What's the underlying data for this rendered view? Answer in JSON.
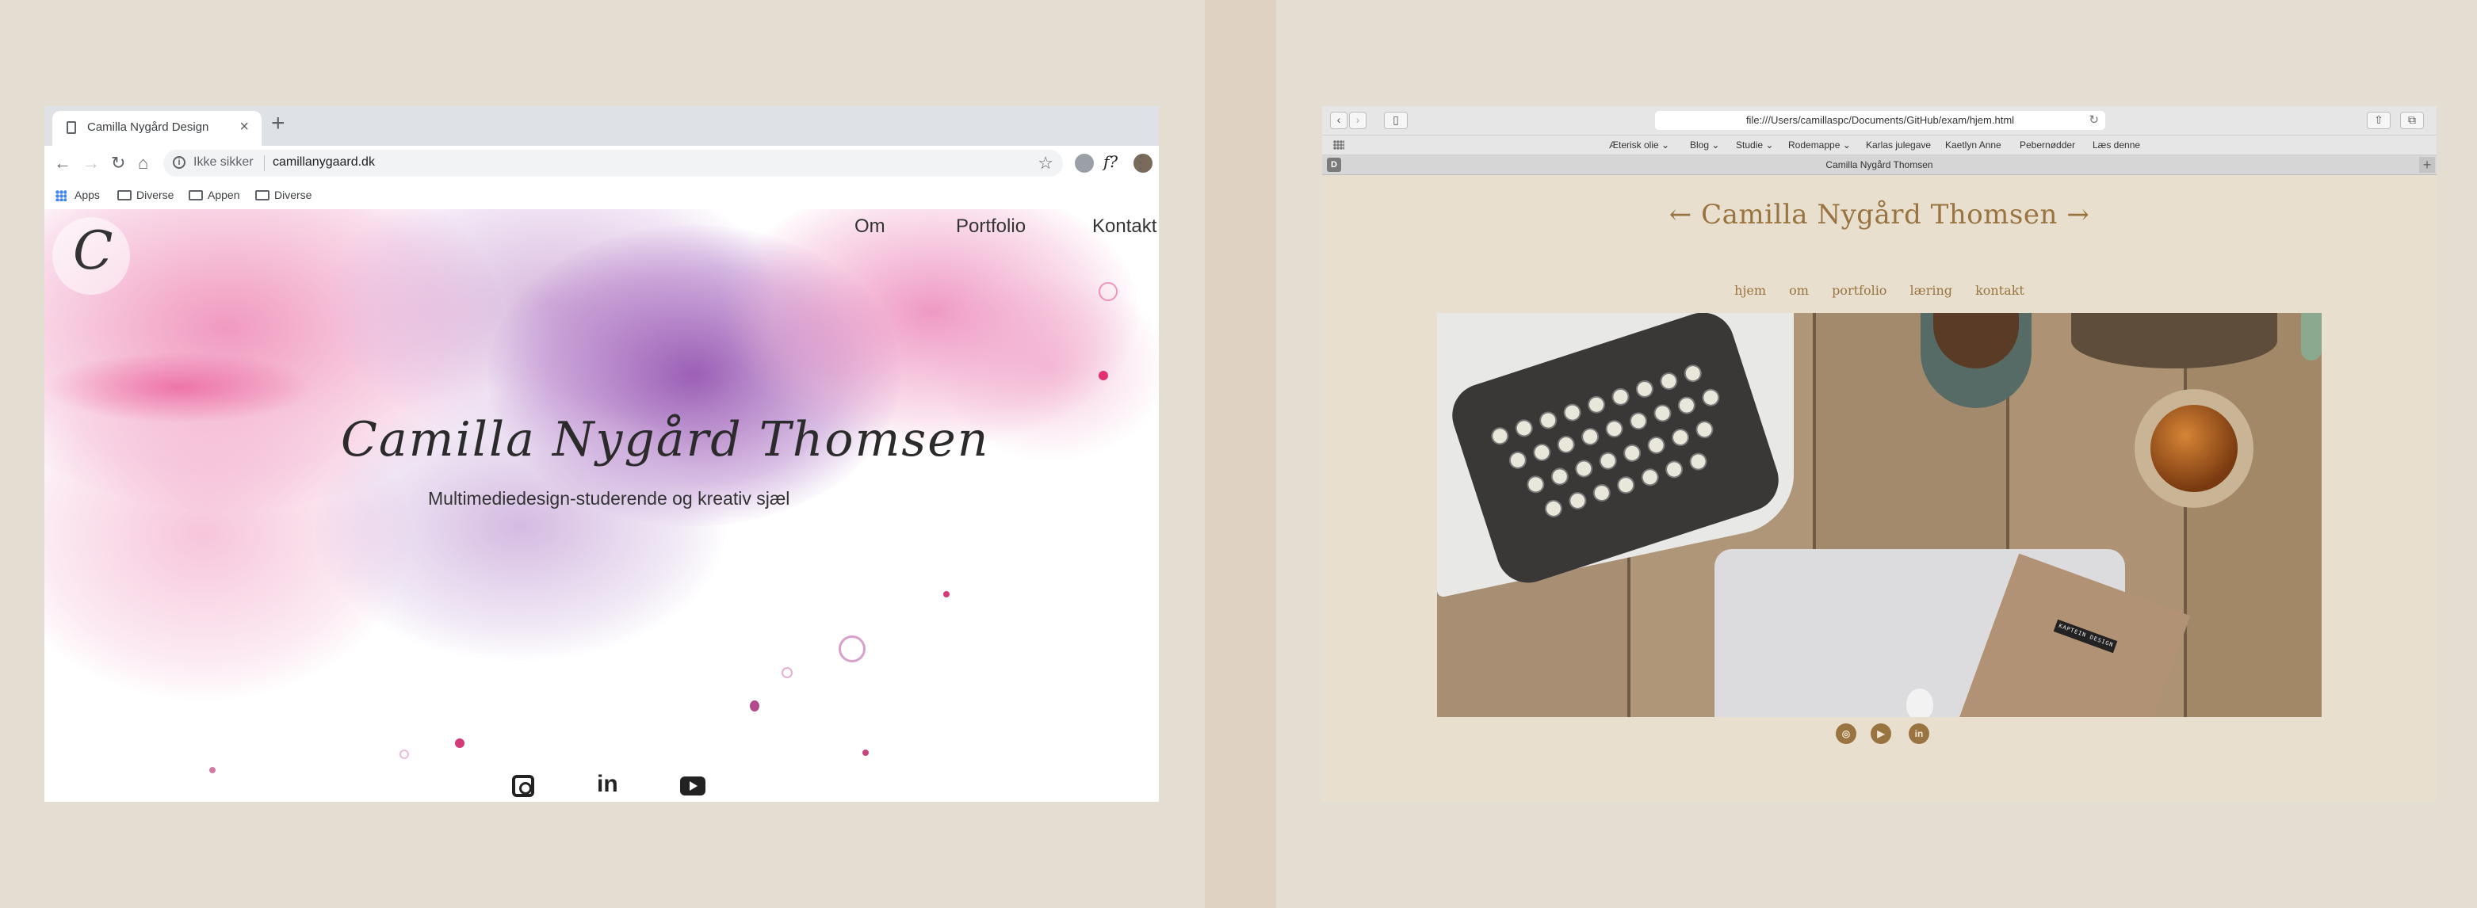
{
  "left_browser": {
    "tab_title": "Camilla Nygård Design",
    "tab_close": "×",
    "new_tab": "+",
    "back": "←",
    "forward": "→",
    "reload": "↻",
    "home": "⌂",
    "security_label": "Ikke sikker",
    "url": "camillanygaard.dk",
    "star": "☆",
    "ext_f": "f?",
    "menu": "⋮",
    "bookmarks": [
      "Apps",
      "Diverse",
      "Appen",
      "Diverse"
    ]
  },
  "left_site": {
    "logo": "C",
    "nav": [
      "Om",
      "Portfolio",
      "Kontakt"
    ],
    "title": "Camilla Nygård Thomsen",
    "subtitle": "Multimediedesign-studerende og kreativ sjæl",
    "linkedin": "in",
    "social_icons": [
      "instagram-icon",
      "linkedin-icon",
      "youtube-icon"
    ]
  },
  "right_browser": {
    "back": "‹",
    "forward": "›",
    "url": "file:///Users/camillaspc/Documents/GitHub/exam/hjem.html",
    "reload": "↻",
    "bookmarks": [
      "Æterisk olie ⌄",
      "Blog ⌄",
      "Studie ⌄",
      "Rodemappe ⌄",
      "Karlas julegave",
      "Kaetlyn Anne",
      "Pebernødder",
      "Læs denne"
    ],
    "tab_icon": "D",
    "tab_title": "Camilla Nygård Thomsen",
    "new_tab": "+"
  },
  "right_site": {
    "title": "← Camilla Nygård Thomsen →",
    "nav": [
      "hjem",
      "om",
      "portfolio",
      "læring",
      "kontakt"
    ],
    "social_labels": [
      "◎",
      "▶",
      "in"
    ],
    "photo_label": "KAPTEIN DESIGN"
  },
  "colors": {
    "background": "#e4ddd1",
    "safari_page": "#e8dfcf",
    "accent_brown": "#9a7440",
    "watercolor_pink": "#e8609a",
    "watercolor_purple": "#8a4fa8"
  }
}
